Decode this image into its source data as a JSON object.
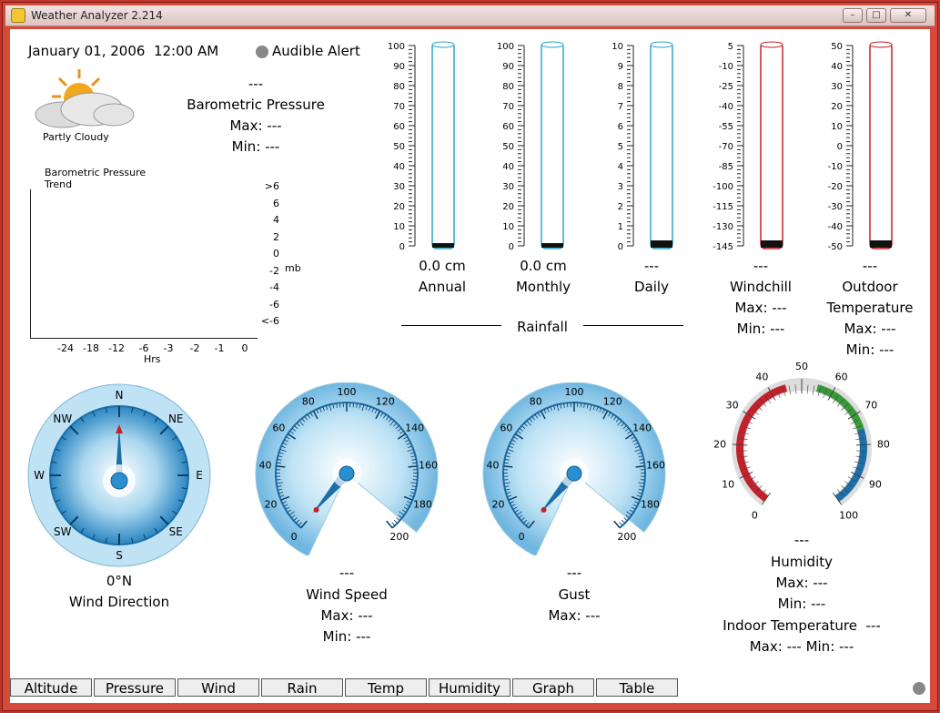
{
  "window": {
    "title": "Weather Analyzer 2.214",
    "minimize_label": "–",
    "maximize_label": "□",
    "close_label": "✕"
  },
  "header": {
    "datetime": "January 01, 2006  12:00 AM",
    "audible_alert": "Audible Alert"
  },
  "condition": {
    "label": "Partly Cloudy",
    "icon": "partly-cloudy-icon"
  },
  "barometer": {
    "value": "---",
    "title": "Barometric Pressure",
    "max": "Max: ---",
    "min": "Min: ---"
  },
  "trend": {
    "title_line1": "Barometric Pressure",
    "title_line2": "Trend",
    "y_ticks": [
      ">6",
      "6",
      "4",
      "2",
      "0",
      "-2",
      "-4",
      "-6",
      "<-6"
    ],
    "x_ticks": [
      "-24",
      "-18",
      "-12",
      "-6",
      "-3",
      "-2",
      "-1",
      "0"
    ],
    "y_unit": "mb",
    "x_unit": "Hrs"
  },
  "rainfall": {
    "title": "Rainfall",
    "gauges": [
      {
        "label": "Annual",
        "value": "0.0 cm",
        "ticks": [
          "100",
          "90",
          "80",
          "70",
          "60",
          "50",
          "40",
          "30",
          "20",
          "10",
          "0"
        ]
      },
      {
        "label": "Monthly",
        "value": "0.0 cm",
        "ticks": [
          "100",
          "90",
          "80",
          "70",
          "60",
          "50",
          "40",
          "30",
          "20",
          "10",
          "0"
        ]
      },
      {
        "label": "Daily",
        "value": "---",
        "ticks": [
          "10",
          "9",
          "8",
          "7",
          "6",
          "5",
          "4",
          "3",
          "2",
          "1",
          "0"
        ]
      }
    ]
  },
  "windchill": {
    "value": "---",
    "label": "Windchill",
    "max": "Max: ---",
    "min": "Min: ---",
    "ticks": [
      "5",
      "-10",
      "-25",
      "-40",
      "-55",
      "-70",
      "-85",
      "-100",
      "-115",
      "-130",
      "-145"
    ]
  },
  "outdoor": {
    "value": "---",
    "label1": "Outdoor",
    "label2": "Temperature",
    "max": "Max: ---",
    "min": "Min: ---",
    "ticks": [
      "50",
      "40",
      "30",
      "20",
      "10",
      "0",
      "-10",
      "-20",
      "-30",
      "-40",
      "-50"
    ]
  },
  "wind_direction": {
    "value": "0°N",
    "label": "Wind Direction",
    "points": [
      "N",
      "NE",
      "E",
      "SE",
      "S",
      "SW",
      "W",
      "NW"
    ]
  },
  "wind_speed": {
    "value": "---",
    "label": "Wind Speed",
    "max": "Max: ---",
    "min": "Min: ---",
    "ticks": [
      "0",
      "20",
      "40",
      "60",
      "80",
      "100",
      "120",
      "140",
      "160",
      "180",
      "200"
    ]
  },
  "gust": {
    "value": "---",
    "label": "Gust",
    "max": "Max: ---",
    "ticks": [
      "0",
      "20",
      "40",
      "60",
      "80",
      "100",
      "120",
      "140",
      "160",
      "180",
      "200"
    ]
  },
  "humidity": {
    "value": "---",
    "label": "Humidity",
    "max": "Max: ---",
    "min": "Min: ---",
    "ticks": [
      "0",
      "10",
      "20",
      "30",
      "40",
      "50",
      "60",
      "70",
      "80",
      "90",
      "100"
    ],
    "indoor_label": "Indoor Temperature  ---",
    "indoor_maxmin": "Max: --- Min: ---"
  },
  "tabs": [
    "Altitude",
    "Pressure",
    "Wind",
    "Rain",
    "Temp",
    "Humidity",
    "Graph",
    "Table"
  ],
  "colors": {
    "frame": "#d64a3c",
    "rain_tube": "#2aa7c7",
    "temp_tube": "#c8202a",
    "dial_blue": "#1c6fa8",
    "humid_red": "#c8202a",
    "humid_green": "#3a9a3a",
    "humid_blue": "#1c6fa8"
  }
}
